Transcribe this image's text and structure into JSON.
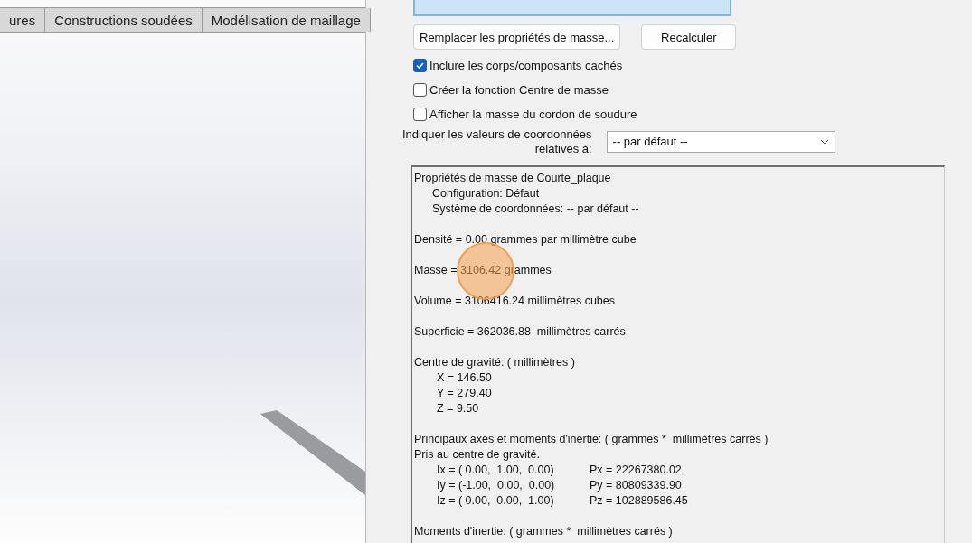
{
  "tabs": [
    {
      "label": "ures",
      "selected": false
    },
    {
      "label": "Constructions soudées",
      "selected": false
    },
    {
      "label": "Modélisation de maillage",
      "selected": false
    }
  ],
  "buttons": [
    {
      "label": "Remplacer les propriétés de masse..."
    },
    {
      "label": "Recalculer"
    }
  ],
  "options": [
    {
      "label": "Inclure les corps/composants cachés",
      "checked": true
    },
    {
      "label": "Créer la fonction Centre de masse",
      "checked": false
    },
    {
      "label": "Afficher la masse du cordon de soudure",
      "checked": false
    }
  ],
  "coordinate_select": {
    "label_lines": [
      "Indiquer les valeurs de coordonnées",
      "relatives à:"
    ],
    "value": "-- par défaut --"
  },
  "report": {
    "sections": [
      {
        "lines": [
          {
            "kind": "plain",
            "text": "Propriétés de masse de Courte_plaque"
          },
          {
            "kind": "indent",
            "text": "Configuration: Défaut"
          },
          {
            "kind": "indent",
            "text": "Système de coordonnées: -- par défaut --"
          }
        ]
      },
      {
        "lines": [
          {
            "kind": "plain",
            "text": "Densité = 0.00 grammes par millimètre cube"
          }
        ]
      },
      {
        "lines": [
          {
            "kind": "plain",
            "text": "Masse = 3106.42 grammes"
          }
        ]
      },
      {
        "lines": [
          {
            "kind": "plain",
            "text": "Volume = 3106416.24 millimètres cubes"
          }
        ]
      },
      {
        "lines": [
          {
            "kind": "plain",
            "text": "Superficie = 362036.88  millimètres carrés"
          }
        ]
      },
      {
        "lines": [
          {
            "kind": "plain",
            "text": "Centre de gravité: ( millimètres )"
          },
          {
            "kind": "value",
            "text": "X = 146.50"
          },
          {
            "kind": "value",
            "text": "Y = 279.40"
          },
          {
            "kind": "value",
            "text": "Z = 9.50"
          }
        ]
      },
      {
        "lines": [
          {
            "kind": "plain",
            "text": "Principaux axes et moments d'inertie: ( grammes *  millimètres carrés )"
          },
          {
            "kind": "plain",
            "text": "Pris au centre de gravité."
          },
          {
            "kind": "pair",
            "text": "Ix = ( 0.00,  1.00,  0.00)",
            "value": "Px = 22267380.02"
          },
          {
            "kind": "pair",
            "text": "Iy = (-1.00,  0.00,  0.00)",
            "value": "Py = 80809339.90"
          },
          {
            "kind": "pair",
            "text": "Iz = ( 0.00,  0.00,  1.00)",
            "value": "Pz = 102889586.45"
          }
        ]
      },
      {
        "lines": [
          {
            "kind": "plain",
            "text": "Moments d'inertie: ( grammes *  millimètres carrés )"
          }
        ]
      }
    ]
  }
}
